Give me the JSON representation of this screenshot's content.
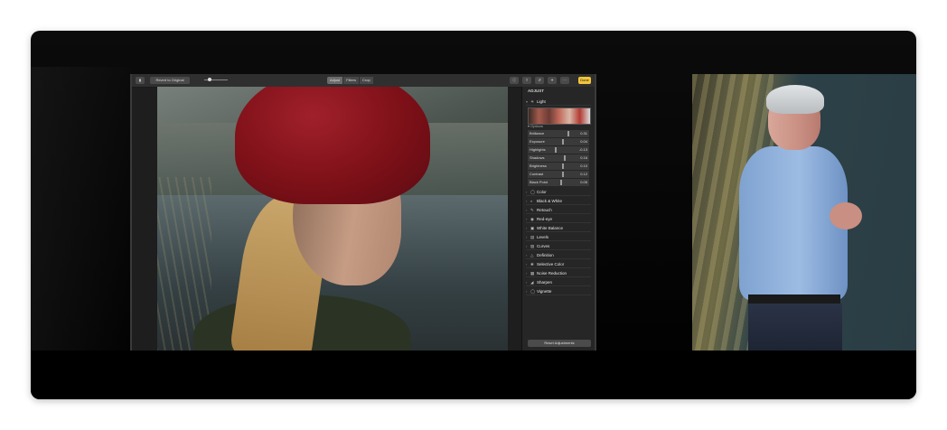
{
  "toolbar": {
    "reset_label": "Revert to Original",
    "tabs": [
      "Adjust",
      "Filters",
      "Crop"
    ],
    "active_tab": "Adjust",
    "done_label": "Done"
  },
  "panel": {
    "header": "ADJUST",
    "light_label": "Light",
    "options_label": "Options",
    "sliders": [
      {
        "label": "Brilliance",
        "value": "0.31"
      },
      {
        "label": "Exposure",
        "value": "0.04"
      },
      {
        "label": "Highlights",
        "value": "-0.13"
      },
      {
        "label": "Shadows",
        "value": "0.16"
      },
      {
        "label": "Brightness",
        "value": "0.10"
      },
      {
        "label": "Contrast",
        "value": "0.12"
      },
      {
        "label": "Black Point",
        "value": "0.05"
      }
    ],
    "items": [
      {
        "label": "Color"
      },
      {
        "label": "Black & White"
      },
      {
        "label": "Retouch"
      },
      {
        "label": "Red-eye"
      },
      {
        "label": "White Balance"
      },
      {
        "label": "Levels"
      },
      {
        "label": "Curves"
      },
      {
        "label": "Definition"
      },
      {
        "label": "Selective Color"
      },
      {
        "label": "Noise Reduction"
      },
      {
        "label": "Sharpen"
      },
      {
        "label": "Vignette"
      }
    ],
    "reset_button": "Reset Adjustments"
  },
  "colors": {
    "accent_done": "#f2c43c",
    "panel_bg": "#262626",
    "hat_red": "#7d1018",
    "shirt_blue": "#8eb1de"
  }
}
